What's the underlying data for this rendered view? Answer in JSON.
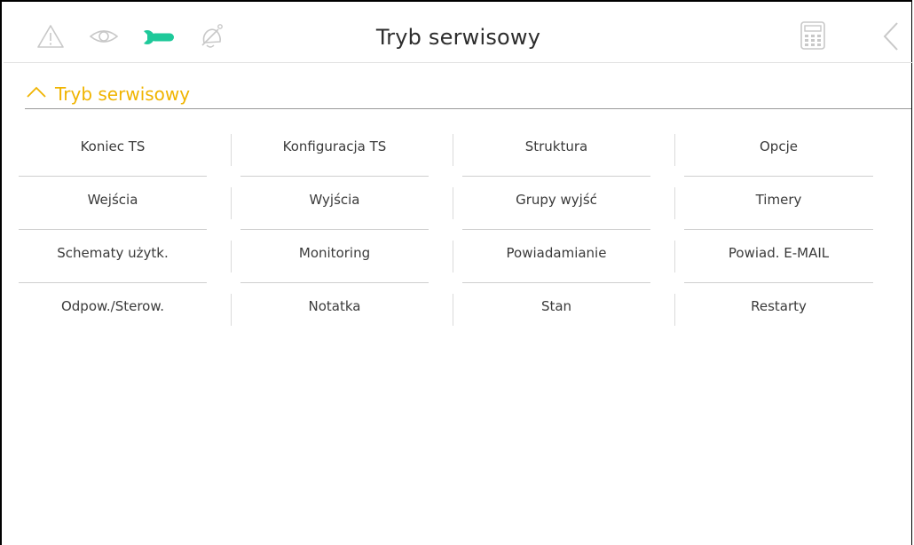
{
  "header": {
    "title": "Tryb serwisowy",
    "icons": {
      "warning": "warning-icon",
      "eye": "eye-icon",
      "wrench": "wrench-icon",
      "bell": "bell-off-icon",
      "keypad": "keypad-icon",
      "back": "back-chevron-icon"
    },
    "active_color": "#1ec99a",
    "inactive_color": "#c8c8c8"
  },
  "section": {
    "title": "Tryb serwisowy",
    "color": "#f0b400",
    "expanded": true
  },
  "menu": {
    "rows": [
      [
        "Koniec TS",
        "Konfiguracja TS",
        "Struktura",
        "Opcje"
      ],
      [
        "Wejścia",
        "Wyjścia",
        "Grupy wyjść",
        "Timery"
      ],
      [
        "Schematy użytk.",
        "Monitoring",
        "Powiadamianie",
        "Powiad. E-MAIL"
      ],
      [
        "Odpow./Sterow.",
        "Notatka",
        "Stan",
        "Restarty"
      ]
    ]
  }
}
